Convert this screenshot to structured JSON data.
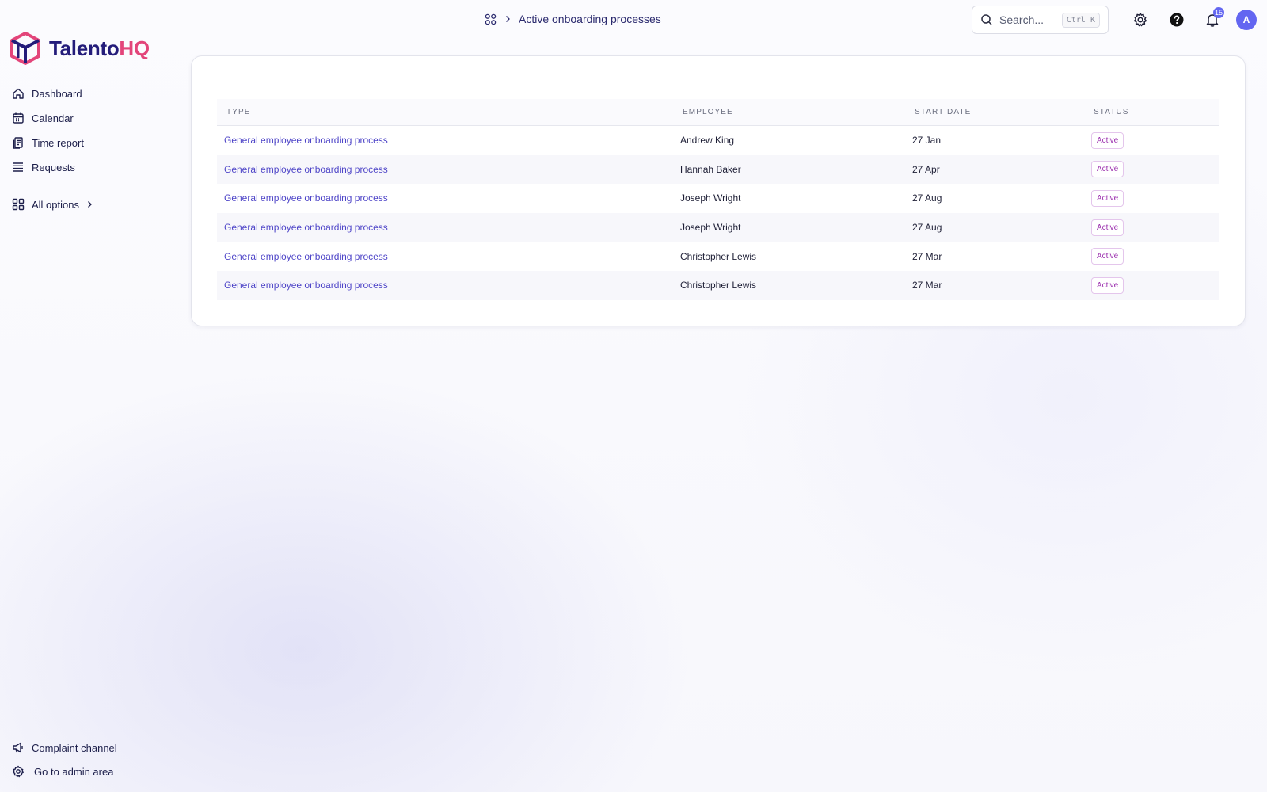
{
  "app": {
    "logo_main": "Talento",
    "logo_accent": "HQ",
    "logo_colors": {
      "primary": "#241c7a",
      "accent": "#e3457a"
    }
  },
  "sidebar": {
    "items": [
      {
        "label": "Dashboard",
        "icon": "home-icon"
      },
      {
        "label": "Calendar",
        "icon": "calendar-icon"
      },
      {
        "label": "Time report",
        "icon": "clipboard-icon"
      },
      {
        "label": "Requests",
        "icon": "list-icon"
      }
    ],
    "all_options": {
      "label": "All options",
      "icon": "grid-icon"
    },
    "bottom": [
      {
        "label": "Complaint channel",
        "icon": "megaphone-icon"
      },
      {
        "label": "Go to admin area",
        "icon": "gear-icon"
      }
    ]
  },
  "header": {
    "breadcrumb_title": "Active onboarding processes",
    "search": {
      "placeholder": "Search...",
      "shortcut": "Ctrl K"
    },
    "notifications_count": "15",
    "avatar_initial": "A"
  },
  "table": {
    "columns": [
      "Type",
      "Employee",
      "Start date",
      "Status"
    ],
    "rows": [
      {
        "type": "General employee onboarding process",
        "employee": "Andrew King",
        "start": "27 Jan",
        "status": "Active"
      },
      {
        "type": "General employee onboarding process",
        "employee": "Hannah Baker",
        "start": "27 Apr",
        "status": "Active"
      },
      {
        "type": "General employee onboarding process",
        "employee": "Joseph Wright",
        "start": "27 Aug",
        "status": "Active"
      },
      {
        "type": "General employee onboarding process",
        "employee": "Joseph Wright",
        "start": "27 Aug",
        "status": "Active"
      },
      {
        "type": "General employee onboarding process",
        "employee": "Christopher Lewis",
        "start": "27 Mar",
        "status": "Active"
      },
      {
        "type": "General employee onboarding process",
        "employee": "Christopher Lewis",
        "start": "27 Mar",
        "status": "Active"
      }
    ]
  },
  "colors": {
    "link": "#4f46c8",
    "status_active_text": "#9b2fae",
    "badge": "#6366f1"
  }
}
